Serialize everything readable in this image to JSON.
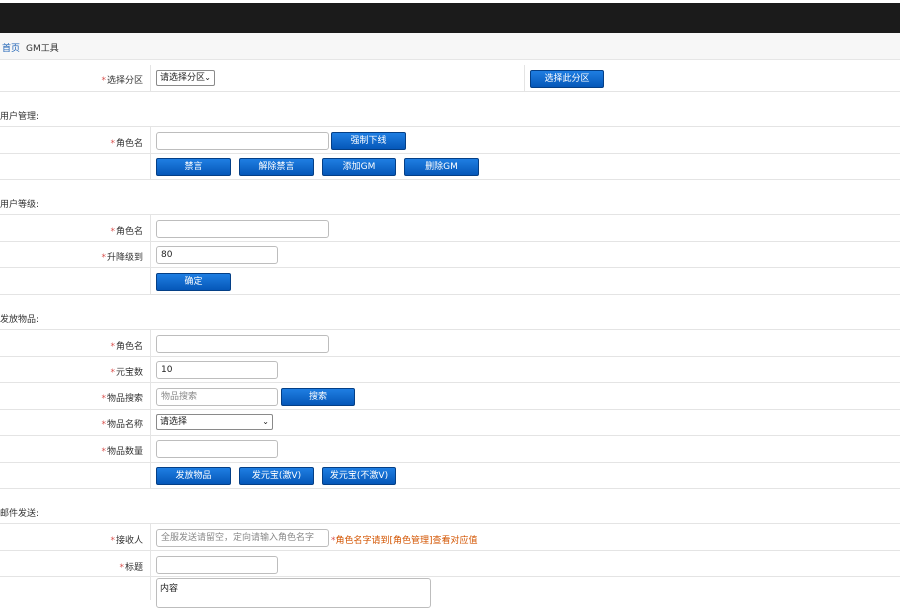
{
  "breadcrumb": {
    "home": "首页",
    "current": "GM工具"
  },
  "zone": {
    "label": "选择分区",
    "select_value": "请选择分区",
    "button": "选择此分区"
  },
  "user_mgmt": {
    "title": "用户管理:",
    "role_label": "角色名",
    "role_value": "",
    "kick_button": "强制下线",
    "mute_button": "禁言",
    "unmute_button": "解除禁言",
    "add_gm_button": "添加GM",
    "del_gm_button": "删除GM"
  },
  "user_level": {
    "title": "用户等级:",
    "role_label": "角色名",
    "role_value": "",
    "level_label": "升降级到",
    "level_value": "80",
    "confirm_button": "确定"
  },
  "items": {
    "title": "发放物品:",
    "role_label": "角色名",
    "role_value": "",
    "yuanbao_label": "元宝数",
    "yuanbao_value": "10",
    "search_label": "物品搜索",
    "search_placeholder": "物品搜索",
    "search_button": "搜索",
    "name_label": "物品名称",
    "name_select": "请选择",
    "qty_label": "物品数量",
    "qty_value": "",
    "send_item_button": "发放物品",
    "send_yb_counted_button": "发元宝(激V)",
    "send_yb_uncounted_button": "发元宝(不激V)"
  },
  "mail": {
    "title": "邮件发送:",
    "recipient_label": "接收人",
    "recipient_placeholder": "全服发送请留空，定向请输入角色名字",
    "hint_prefix": "*",
    "hint_text": "角色名字请到[角色管理]查看对应值",
    "subject_label": "标题",
    "subject_value": "",
    "content_value": "内容"
  },
  "colors": {
    "topbar": "#1b1b1b",
    "button": "#0b67cc",
    "required_star": "#d9534f",
    "hint": "#d35400",
    "link": "#1a5fb4"
  }
}
